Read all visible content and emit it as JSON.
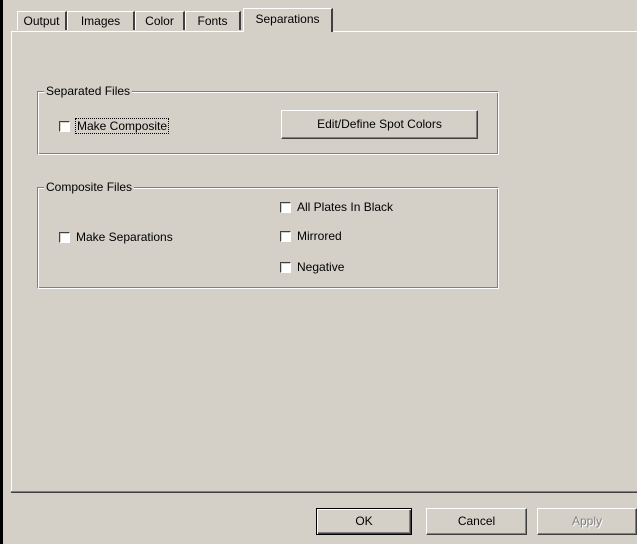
{
  "tabs": [
    {
      "label": "Output"
    },
    {
      "label": "Images"
    },
    {
      "label": "Color"
    },
    {
      "label": "Fonts"
    },
    {
      "label": "Separations",
      "active": true
    }
  ],
  "separated_files": {
    "title": "Separated Files",
    "make_composite": {
      "label": "Make Composite",
      "checked": false
    },
    "edit_spot_colors_button": "Edit/Define Spot Colors"
  },
  "composite_files": {
    "title": "Composite Files",
    "make_separations": {
      "label": "Make Separations",
      "checked": false
    },
    "all_plates_in_black": {
      "label": "All Plates In Black",
      "checked": false
    },
    "mirrored": {
      "label": "Mirrored",
      "checked": false
    },
    "negative": {
      "label": "Negative",
      "checked": false
    }
  },
  "footer": {
    "ok_label": "OK",
    "cancel_label": "Cancel",
    "apply_label": "Apply"
  },
  "colors": {
    "face": "#d4d0c8",
    "shadow": "#808080",
    "dark_shadow": "#404040",
    "highlight": "#ffffff"
  }
}
